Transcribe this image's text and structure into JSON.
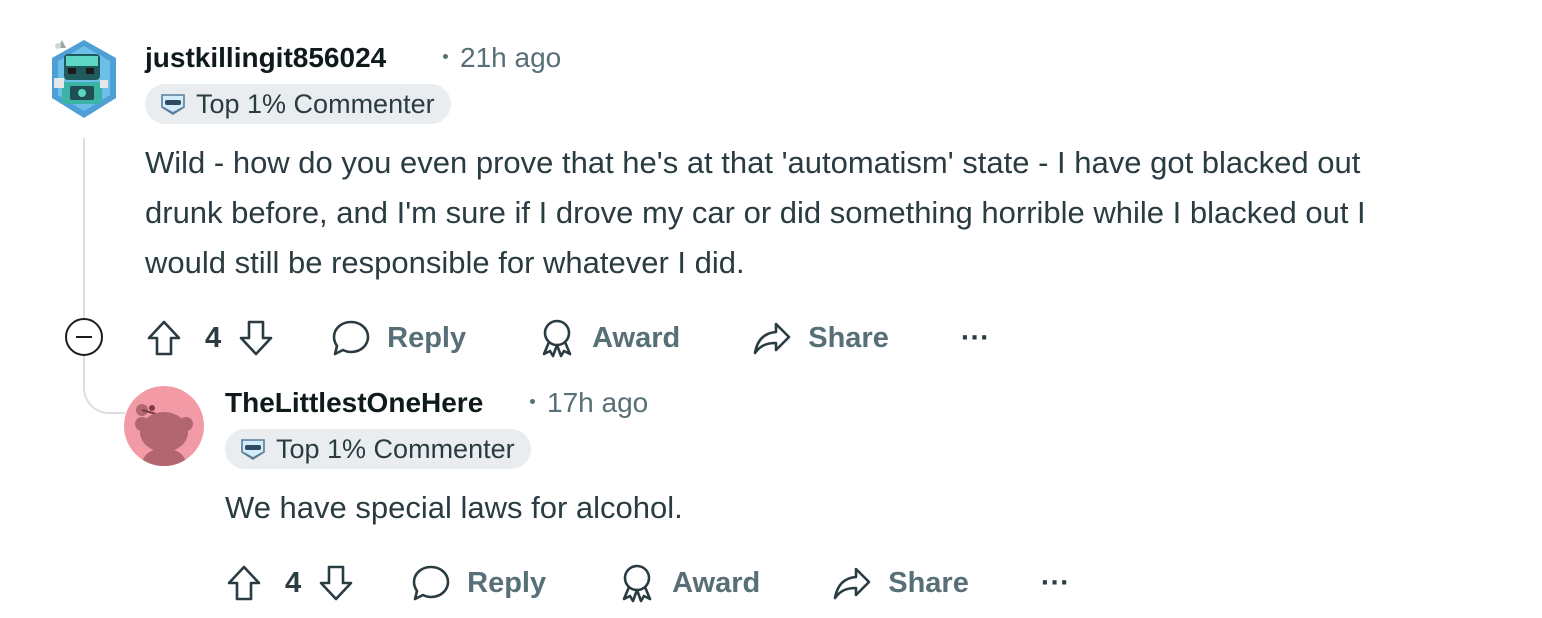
{
  "comments": [
    {
      "author": "justkillingit856024",
      "time": "21h ago",
      "flair": "Top 1% Commenter",
      "text": "Wild - how do you even prove that he's at that 'automatism' state - I have got blacked out drunk before, and I'm sure if I drove my car or did something horrible while I blacked out I would still be responsible for whatever I did.",
      "score": "4",
      "actions": {
        "reply": "Reply",
        "award": "Award",
        "share": "Share",
        "more": "···"
      }
    },
    {
      "author": "TheLittlestOneHere",
      "time": "17h ago",
      "flair": "Top 1% Commenter",
      "text": "We have special laws for alcohol.",
      "score": "4",
      "actions": {
        "reply": "Reply",
        "award": "Award",
        "share": "Share",
        "more": "···"
      }
    }
  ],
  "colors": {
    "text": "#2a3c42",
    "muted": "#576f76",
    "flair_bg": "#eaedef",
    "thread_line": "#dcdfe1",
    "avatar2_bg": "#f29aa6"
  },
  "icons": [
    "upvote-icon",
    "downvote-icon",
    "reply-icon",
    "award-icon",
    "share-icon",
    "more-icon",
    "collapse-icon",
    "flair-icon"
  ]
}
